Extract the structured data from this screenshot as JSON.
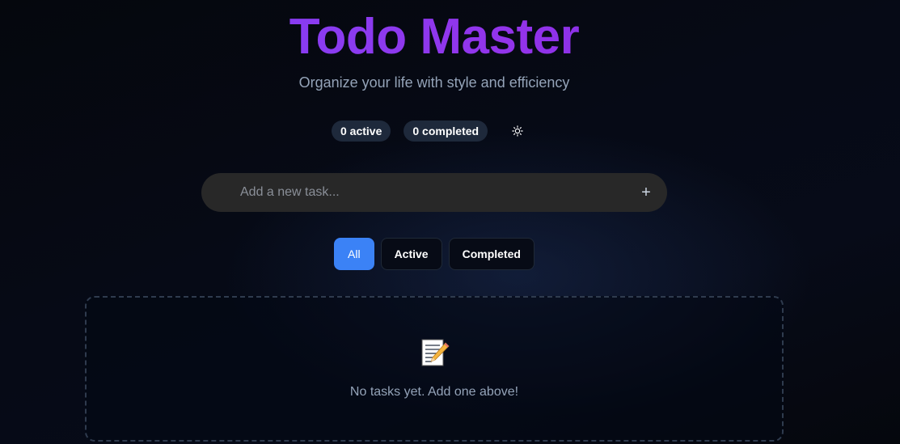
{
  "header": {
    "title": "Todo Master",
    "subtitle": "Organize your life with style and efficiency"
  },
  "stats": {
    "active_label": "0 active",
    "completed_label": "0 completed",
    "theme_icon": "sun-icon"
  },
  "add_task": {
    "placeholder": "Add a new task...",
    "value": "",
    "add_icon": "plus-icon",
    "add_label": "+"
  },
  "filters": {
    "all": "All",
    "active": "Active",
    "completed": "Completed",
    "selected": "All"
  },
  "empty_state": {
    "icon": "memo-icon",
    "message": "No tasks yet. Add one above!"
  },
  "colors": {
    "accent": "#3b82f6",
    "title_gradient_start": "#7c3aed",
    "title_gradient_end": "#9333ea",
    "background": "#05070d"
  }
}
